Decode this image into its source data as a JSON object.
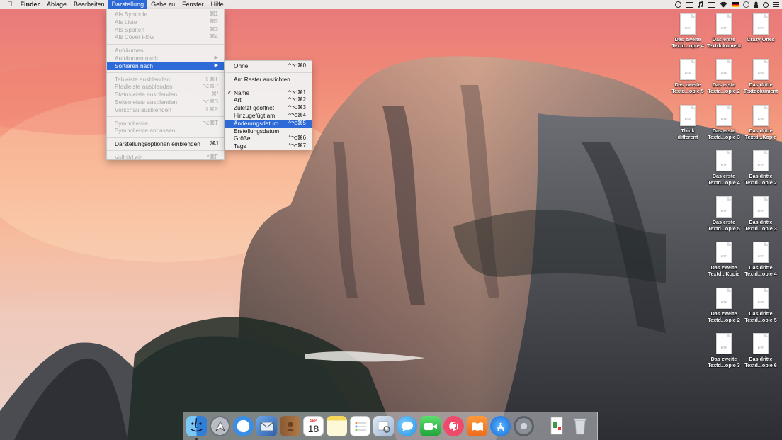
{
  "menubar": {
    "apple": "",
    "app": "Finder",
    "items": [
      "Ablage",
      "Bearbeiten",
      "Darstellung",
      "Gehe zu",
      "Fenster",
      "Hilfe"
    ],
    "active": "Darstellung"
  },
  "menu": {
    "items": [
      {
        "label": "Als Symbole",
        "shortcut": "⌘1",
        "disabled": true
      },
      {
        "label": "Als Liste",
        "shortcut": "⌘2",
        "disabled": true
      },
      {
        "label": "Als Spalten",
        "shortcut": "⌘3",
        "disabled": true
      },
      {
        "label": "Als Cover Flow",
        "shortcut": "⌘4",
        "disabled": true
      },
      {
        "label": "Aufräumen",
        "shortcut": "",
        "disabled": true
      },
      {
        "label": "Aufräumen nach",
        "shortcut": "▶",
        "disabled": true
      },
      {
        "label": "Sortieren nach",
        "shortcut": "▶",
        "disabled": false,
        "highlighted": true
      },
      {
        "label": "Tableiste ausblenden",
        "shortcut": "⇧⌘T",
        "disabled": true
      },
      {
        "label": "Pfadleiste ausblenden",
        "shortcut": "⌥⌘P",
        "disabled": true
      },
      {
        "label": "Statusleiste ausblenden",
        "shortcut": "⌘/",
        "disabled": true
      },
      {
        "label": "Seitenleiste ausblenden",
        "shortcut": "⌥⌘S",
        "disabled": true
      },
      {
        "label": "Vorschau ausblenden",
        "shortcut": "⇧⌘P",
        "disabled": true
      },
      {
        "label": "Symbolleiste",
        "shortcut": "⌥⌘T",
        "disabled": true
      },
      {
        "label": "Symbolleiste anpassen …",
        "shortcut": "",
        "disabled": true
      },
      {
        "label": "Darstellungsoptionen einblenden",
        "shortcut": "⌘J",
        "disabled": false
      },
      {
        "label": "Vollbild ein",
        "shortcut": "^⌘F",
        "disabled": true
      }
    ]
  },
  "submenu": {
    "items": [
      {
        "label": "Ohne",
        "shortcut": "^⌥⌘0"
      },
      {
        "label": "Am Raster ausrichten",
        "shortcut": ""
      },
      {
        "label": "Name",
        "shortcut": "^⌥⌘1",
        "checked": "✓"
      },
      {
        "label": "Art",
        "shortcut": "^⌥⌘2"
      },
      {
        "label": "Zuletzt geöffnet",
        "shortcut": "^⌥⌘3"
      },
      {
        "label": "Hinzugefügt am",
        "shortcut": "^⌥⌘4"
      },
      {
        "label": "Änderungsdatum",
        "shortcut": "^⌥⌘5",
        "highlighted": true
      },
      {
        "label": "Erstellungsdatum",
        "shortcut": ""
      },
      {
        "label": "Größe",
        "shortcut": "^⌥⌘6"
      },
      {
        "label": "Tags",
        "shortcut": "^⌥⌘7"
      }
    ]
  },
  "desktop": {
    "icon_type": "RTF",
    "icons": [
      [
        "Das zweite",
        "Textd...opie 4"
      ],
      [
        "Das erste",
        "Textdokument"
      ],
      [
        "Crazy Ones",
        ""
      ],
      [
        "Das zweite",
        "Textd...opie 5"
      ],
      [
        "Das erste",
        "Textd...opie 2"
      ],
      [
        "Das dritte",
        "Textdokument"
      ],
      [
        "Think",
        "different"
      ],
      [
        "Das erste",
        "Textd...opie 3"
      ],
      [
        "Das dritte",
        "Textd...Kopie"
      ],
      [
        "Das erste",
        "Textd...opie 4"
      ],
      [
        "Das dritte",
        "Textd...opie 2"
      ],
      [
        "Das erste",
        "Textd...opie 5"
      ],
      [
        "Das dritte",
        "Textd...opie 3"
      ],
      [
        "Das zweite",
        "Textd...Kopie"
      ],
      [
        "Das dritte",
        "Textd...opie 4"
      ],
      [
        "Das zweite",
        "Textd...opie 2"
      ],
      [
        "Das dritte",
        "Textd...opie 5"
      ],
      [
        "Das zweite",
        "Textd...opie 3"
      ],
      [
        "Das dritte",
        "Textd...opie 6"
      ]
    ]
  },
  "dock": {
    "calendar_month": "SEP",
    "calendar_day": "18",
    "apps": [
      "finder-icon",
      "launchpad-icon",
      "safari-icon",
      "mail-icon",
      "contacts-icon",
      "calendar-icon",
      "notes-icon",
      "reminders-icon",
      "preview-icon",
      "messages-icon",
      "facetime-icon",
      "itunes-icon",
      "ibooks-icon",
      "app-store-icon",
      "system-preferences-icon",
      "document-icon",
      "trash-icon"
    ]
  },
  "colors": {
    "accent": "#2d6ad8"
  }
}
